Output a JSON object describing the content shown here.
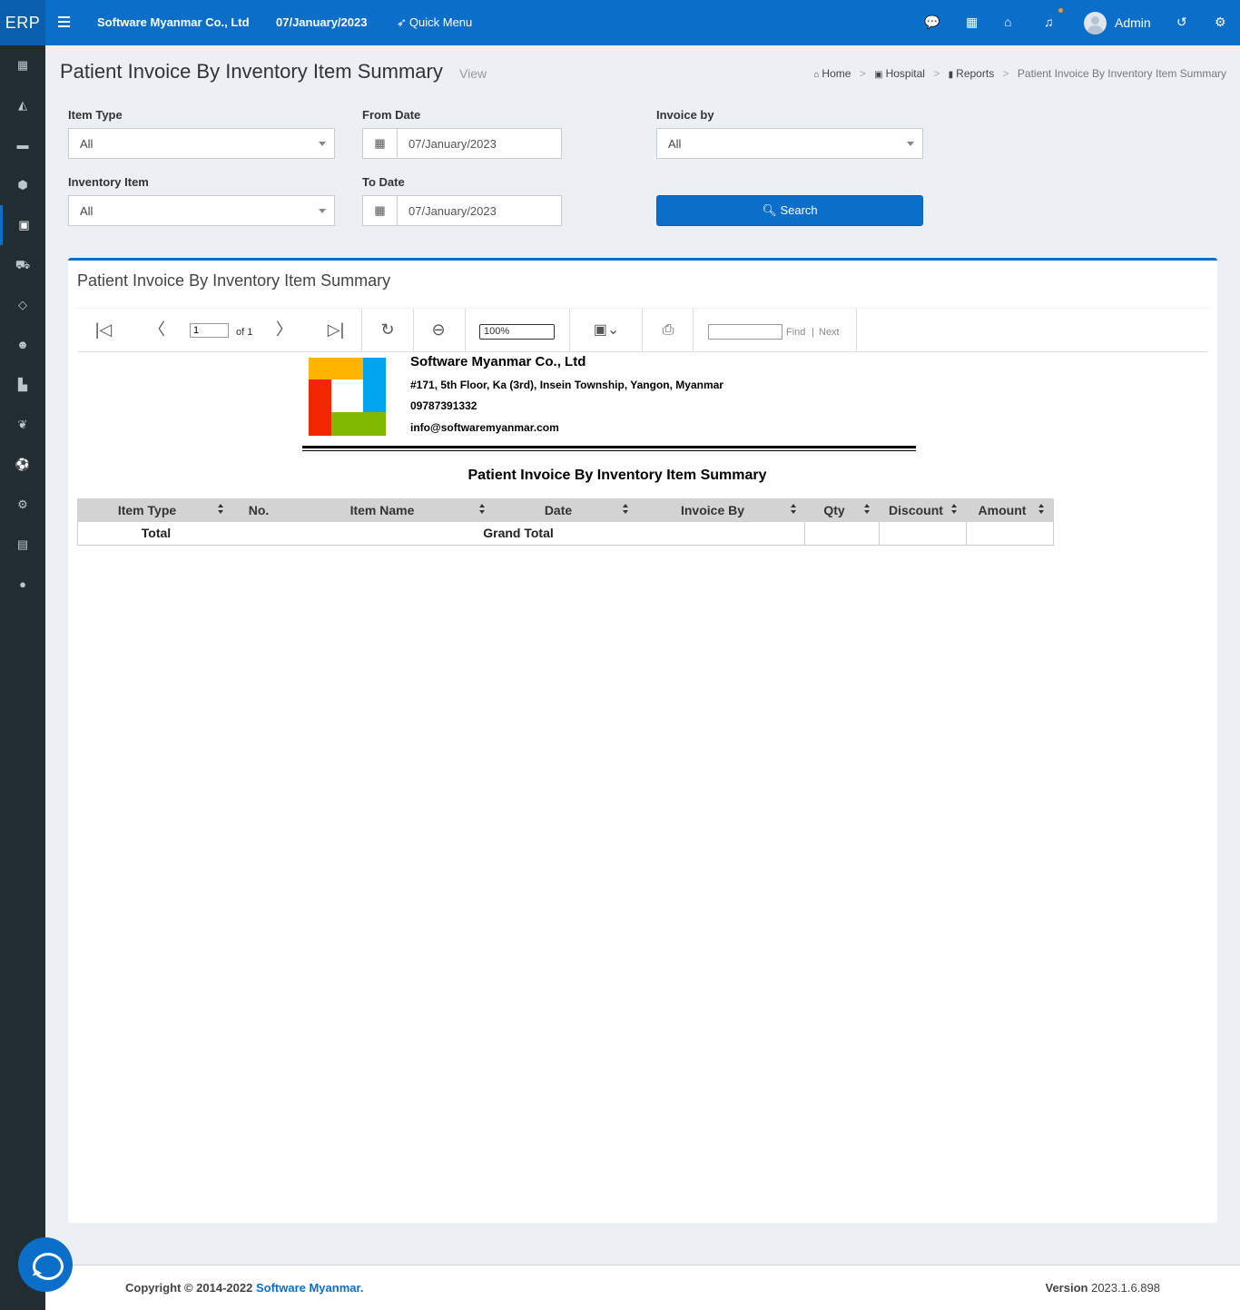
{
  "topbar": {
    "logo": "ERP",
    "company": "Software Myanmar Co., Ltd",
    "date": "07/January/2023",
    "quick_menu": "Quick Menu",
    "user": "Admin"
  },
  "sidebar": {
    "items": [
      {
        "icon": "calculator-icon",
        "glyph": "▦"
      },
      {
        "icon": "area-chart-icon",
        "glyph": "◭"
      },
      {
        "icon": "credit-card-icon",
        "glyph": "▬"
      },
      {
        "icon": "cube-icon",
        "glyph": "⬢"
      },
      {
        "icon": "clipboard-hospital-icon",
        "glyph": "▣"
      },
      {
        "icon": "shopping-cart-icon",
        "glyph": "⛟"
      },
      {
        "icon": "diamond-icon",
        "glyph": "◇"
      },
      {
        "icon": "users-icon",
        "glyph": "☻"
      },
      {
        "icon": "industry-icon",
        "glyph": "▙"
      },
      {
        "icon": "leaf-icon",
        "glyph": "❦"
      },
      {
        "icon": "soccer-ball-icon",
        "glyph": "⚽"
      },
      {
        "icon": "gear-icon",
        "glyph": "⚙"
      },
      {
        "icon": "book-icon",
        "glyph": "▤"
      },
      {
        "icon": "comment-icon",
        "glyph": "●"
      }
    ],
    "active_index": 4
  },
  "header": {
    "title": "Patient Invoice By Inventory Item Summary",
    "subtitle": "View",
    "breadcrumb": [
      "Home",
      "Hospital",
      "Reports",
      "Patient Invoice By Inventory Item Summary"
    ]
  },
  "form": {
    "item_type": {
      "label": "Item Type",
      "value": "All"
    },
    "inventory_item": {
      "label": "Inventory Item",
      "value": "All"
    },
    "from_date": {
      "label": "From Date",
      "value": "07/January/2023"
    },
    "to_date": {
      "label": "To Date",
      "value": "07/January/2023"
    },
    "invoice_by": {
      "label": "Invoice by",
      "value": "All"
    },
    "search_label": "Search"
  },
  "report_box": {
    "title": "Patient Invoice By Inventory Item Summary",
    "toolbar": {
      "page_value": "1",
      "page_of": "of 1",
      "zoom": "100%",
      "find": "Find",
      "pipe": "|",
      "next": "Next"
    }
  },
  "report": {
    "company": "Software Myanmar Co., Ltd",
    "address": "#171, 5th Floor, Ka (3rd), Insein Township, Yangon, Myanmar",
    "phone": "09787391332",
    "email": "info@softwaremyanmar.com",
    "title": "Patient Invoice By Inventory Item Summary",
    "columns": [
      "Item Type",
      "No.",
      "Item Name",
      "Date",
      "Invoice By",
      "Qty",
      "Discount",
      "Amount"
    ],
    "total_row": {
      "label": "Total",
      "grand_total": "Grand Total",
      "qty": "",
      "discount": "",
      "amount": ""
    }
  },
  "footer": {
    "copyright": "Copyright © 2014-2022 ",
    "link": "Software Myanmar.",
    "version_label": "Version",
    "version": "2023.1.6.898"
  },
  "colors": {
    "primary": "#0b6fc9",
    "sidebar": "#222d32",
    "background": "#ecf0f5",
    "notification_dot": "#f39c12"
  }
}
